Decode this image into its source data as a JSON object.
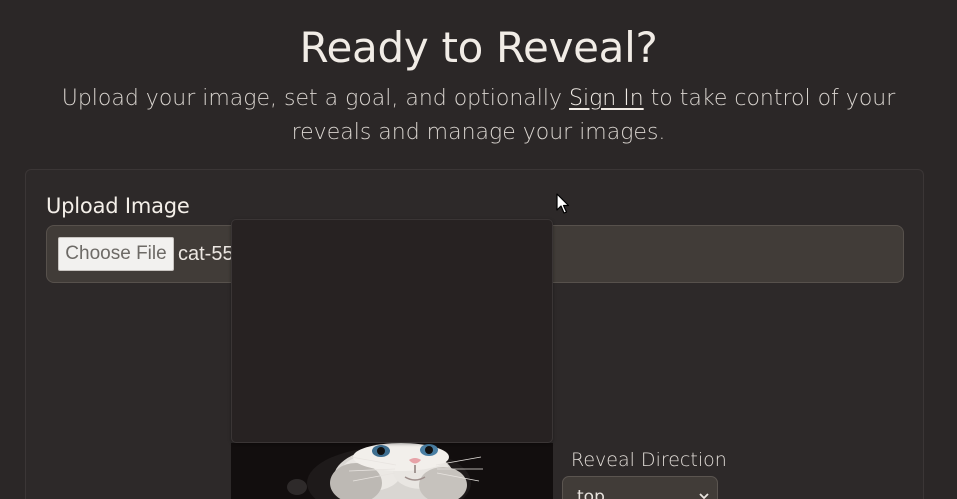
{
  "hero": {
    "title": "Ready to Reveal?",
    "subtitle_before": "Upload your image, set a goal, and optionally",
    "signin_link": "Sign In",
    "subtitle_after": "to take control of your reveals and manage your images."
  },
  "upload": {
    "label": "Upload Image",
    "choose_button": "Choose File",
    "file_name": "cat-55"
  },
  "reveal": {
    "direction_label": "Reveal Direction",
    "direction_value": "top"
  },
  "icons": {
    "cursor": "mouse-pointer-icon",
    "select_arrow": "chevron-down-icon"
  },
  "colors": {
    "background": "#2b2727",
    "input_background": "#413c38",
    "text": "#f1ece6"
  }
}
